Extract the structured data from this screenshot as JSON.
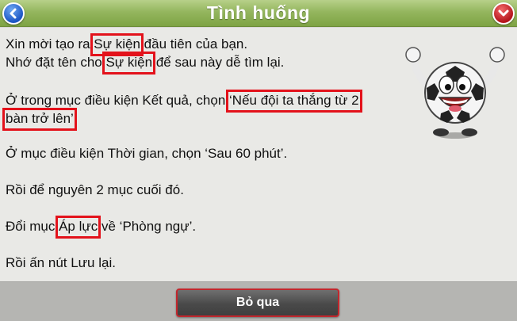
{
  "header": {
    "title": "Tình huống",
    "back_icon": "chevron-left-icon",
    "close_icon": "chevron-down-icon"
  },
  "colors": {
    "title_bar": "#94b65e",
    "highlight_box": "#e3121b",
    "back_button": "#1b55c4",
    "close_button": "#b4141b"
  },
  "message": {
    "l1_pre": "Xin mời tạo ra ",
    "l1_hl": "Sự kiện",
    "l1_post": " đầu tiên của bạn.",
    "l2_pre": "Nhớ đặt tên cho ",
    "l2_hl": "Sự kiện",
    "l2_post": " để sau này dễ tìm lại.",
    "l3_pre": "Ở trong mục điều kiện Kết quả, chọn ",
    "l3_hl": "‘Nếu đội ta thắng từ 2",
    "l4_hl": "bàn trở lên’",
    "l5": "Ở mục điều kiện Thời gian, chọn ‘Sau 60 phút’.",
    "l6": "Rồi để nguyên 2 mục cuối đó.",
    "l7_pre": "Đổi mục ",
    "l7_hl": "Áp lực",
    "l7_post": " về ‘Phòng ngự’.",
    "l8": "Rồi ấn nút Lưu lại."
  },
  "mascot": {
    "icon": "soccer-ball-mascot-icon"
  },
  "footer": {
    "skip_label": "Bỏ qua"
  }
}
